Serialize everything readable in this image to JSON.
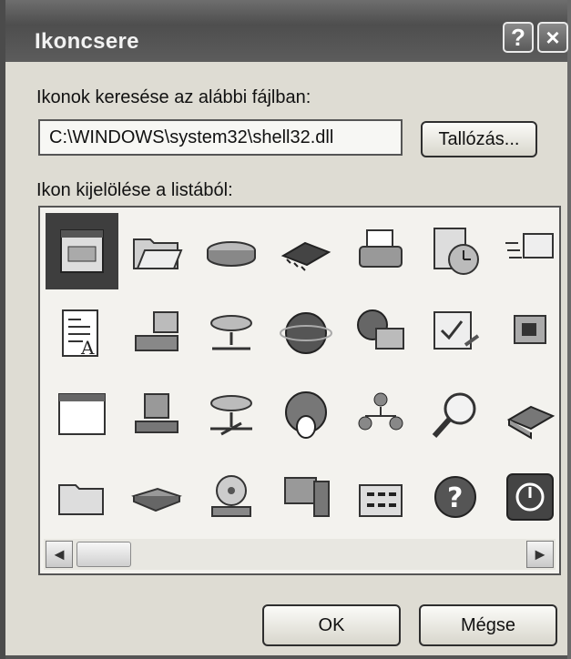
{
  "dialog": {
    "title": "Ikoncsere",
    "help_label": "?",
    "close_label": "×"
  },
  "search": {
    "label": "Ikonok keresése az alábbi fájlban:",
    "path": "C:\\WINDOWS\\system32\\shell32.dll",
    "browse_label": "Tallózás..."
  },
  "list": {
    "label": "Ikon kijelölése a listából:",
    "icons": [
      [
        "program-window-icon",
        "open-folder-icon",
        "hard-drive-icon",
        "memory-chip-icon",
        "printer-icon",
        "clock-document-icon",
        "window-arrow-icon",
        "shortcut-small-icon"
      ],
      [
        "document-text-icon",
        "network-computer-icon",
        "shared-drive-icon",
        "globe-icon",
        "world-computer-icon",
        "checkbox-pen-icon",
        "monitor-icon",
        "shortcut-arrow-icon"
      ],
      [
        "blank-window-icon",
        "drive-share-icon",
        "network-drive-icon",
        "globe-penguin-icon",
        "network-users-icon",
        "magnifier-icon",
        "scanner-icon",
        "clock-small-icon"
      ],
      [
        "folder-icon",
        "flat-drive-icon",
        "cd-drive-icon",
        "computer-tower-icon",
        "folder-grid-icon",
        "help-circle-icon",
        "power-button-icon",
        "partial-icon"
      ]
    ],
    "selected_index": 0,
    "scroll_left": "◄",
    "scroll_right": "►"
  },
  "footer": {
    "ok_label": "OK",
    "cancel_label": "Mégse"
  }
}
